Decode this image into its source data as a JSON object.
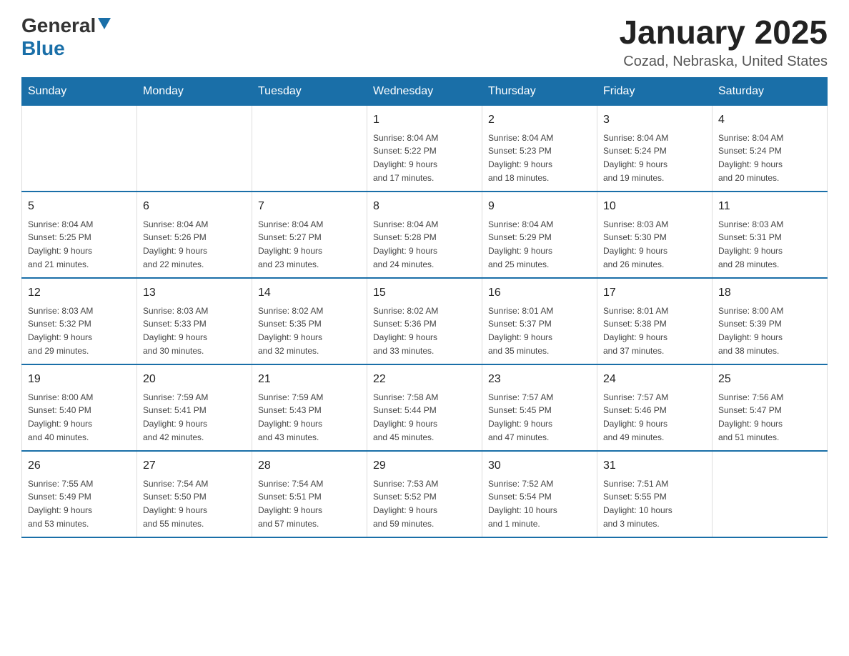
{
  "header": {
    "logo_general": "General",
    "logo_blue": "Blue",
    "title": "January 2025",
    "subtitle": "Cozad, Nebraska, United States"
  },
  "weekdays": [
    "Sunday",
    "Monday",
    "Tuesday",
    "Wednesday",
    "Thursday",
    "Friday",
    "Saturday"
  ],
  "weeks": [
    [
      {
        "day": "",
        "info": ""
      },
      {
        "day": "",
        "info": ""
      },
      {
        "day": "",
        "info": ""
      },
      {
        "day": "1",
        "info": "Sunrise: 8:04 AM\nSunset: 5:22 PM\nDaylight: 9 hours\nand 17 minutes."
      },
      {
        "day": "2",
        "info": "Sunrise: 8:04 AM\nSunset: 5:23 PM\nDaylight: 9 hours\nand 18 minutes."
      },
      {
        "day": "3",
        "info": "Sunrise: 8:04 AM\nSunset: 5:24 PM\nDaylight: 9 hours\nand 19 minutes."
      },
      {
        "day": "4",
        "info": "Sunrise: 8:04 AM\nSunset: 5:24 PM\nDaylight: 9 hours\nand 20 minutes."
      }
    ],
    [
      {
        "day": "5",
        "info": "Sunrise: 8:04 AM\nSunset: 5:25 PM\nDaylight: 9 hours\nand 21 minutes."
      },
      {
        "day": "6",
        "info": "Sunrise: 8:04 AM\nSunset: 5:26 PM\nDaylight: 9 hours\nand 22 minutes."
      },
      {
        "day": "7",
        "info": "Sunrise: 8:04 AM\nSunset: 5:27 PM\nDaylight: 9 hours\nand 23 minutes."
      },
      {
        "day": "8",
        "info": "Sunrise: 8:04 AM\nSunset: 5:28 PM\nDaylight: 9 hours\nand 24 minutes."
      },
      {
        "day": "9",
        "info": "Sunrise: 8:04 AM\nSunset: 5:29 PM\nDaylight: 9 hours\nand 25 minutes."
      },
      {
        "day": "10",
        "info": "Sunrise: 8:03 AM\nSunset: 5:30 PM\nDaylight: 9 hours\nand 26 minutes."
      },
      {
        "day": "11",
        "info": "Sunrise: 8:03 AM\nSunset: 5:31 PM\nDaylight: 9 hours\nand 28 minutes."
      }
    ],
    [
      {
        "day": "12",
        "info": "Sunrise: 8:03 AM\nSunset: 5:32 PM\nDaylight: 9 hours\nand 29 minutes."
      },
      {
        "day": "13",
        "info": "Sunrise: 8:03 AM\nSunset: 5:33 PM\nDaylight: 9 hours\nand 30 minutes."
      },
      {
        "day": "14",
        "info": "Sunrise: 8:02 AM\nSunset: 5:35 PM\nDaylight: 9 hours\nand 32 minutes."
      },
      {
        "day": "15",
        "info": "Sunrise: 8:02 AM\nSunset: 5:36 PM\nDaylight: 9 hours\nand 33 minutes."
      },
      {
        "day": "16",
        "info": "Sunrise: 8:01 AM\nSunset: 5:37 PM\nDaylight: 9 hours\nand 35 minutes."
      },
      {
        "day": "17",
        "info": "Sunrise: 8:01 AM\nSunset: 5:38 PM\nDaylight: 9 hours\nand 37 minutes."
      },
      {
        "day": "18",
        "info": "Sunrise: 8:00 AM\nSunset: 5:39 PM\nDaylight: 9 hours\nand 38 minutes."
      }
    ],
    [
      {
        "day": "19",
        "info": "Sunrise: 8:00 AM\nSunset: 5:40 PM\nDaylight: 9 hours\nand 40 minutes."
      },
      {
        "day": "20",
        "info": "Sunrise: 7:59 AM\nSunset: 5:41 PM\nDaylight: 9 hours\nand 42 minutes."
      },
      {
        "day": "21",
        "info": "Sunrise: 7:59 AM\nSunset: 5:43 PM\nDaylight: 9 hours\nand 43 minutes."
      },
      {
        "day": "22",
        "info": "Sunrise: 7:58 AM\nSunset: 5:44 PM\nDaylight: 9 hours\nand 45 minutes."
      },
      {
        "day": "23",
        "info": "Sunrise: 7:57 AM\nSunset: 5:45 PM\nDaylight: 9 hours\nand 47 minutes."
      },
      {
        "day": "24",
        "info": "Sunrise: 7:57 AM\nSunset: 5:46 PM\nDaylight: 9 hours\nand 49 minutes."
      },
      {
        "day": "25",
        "info": "Sunrise: 7:56 AM\nSunset: 5:47 PM\nDaylight: 9 hours\nand 51 minutes."
      }
    ],
    [
      {
        "day": "26",
        "info": "Sunrise: 7:55 AM\nSunset: 5:49 PM\nDaylight: 9 hours\nand 53 minutes."
      },
      {
        "day": "27",
        "info": "Sunrise: 7:54 AM\nSunset: 5:50 PM\nDaylight: 9 hours\nand 55 minutes."
      },
      {
        "day": "28",
        "info": "Sunrise: 7:54 AM\nSunset: 5:51 PM\nDaylight: 9 hours\nand 57 minutes."
      },
      {
        "day": "29",
        "info": "Sunrise: 7:53 AM\nSunset: 5:52 PM\nDaylight: 9 hours\nand 59 minutes."
      },
      {
        "day": "30",
        "info": "Sunrise: 7:52 AM\nSunset: 5:54 PM\nDaylight: 10 hours\nand 1 minute."
      },
      {
        "day": "31",
        "info": "Sunrise: 7:51 AM\nSunset: 5:55 PM\nDaylight: 10 hours\nand 3 minutes."
      },
      {
        "day": "",
        "info": ""
      }
    ]
  ],
  "colors": {
    "header_bg": "#1a6fa8",
    "header_text": "#ffffff",
    "accent_blue": "#1a6fa8"
  }
}
